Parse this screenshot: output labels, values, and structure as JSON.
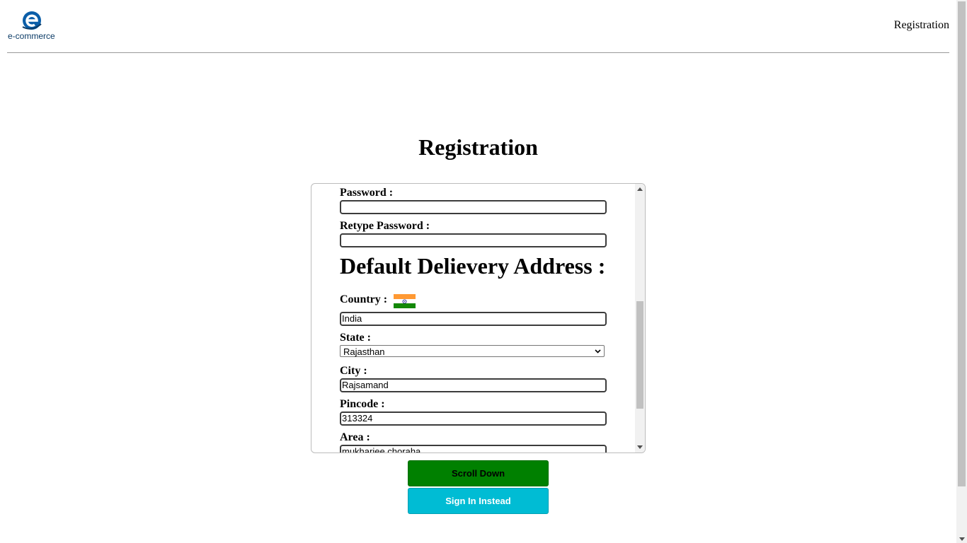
{
  "header": {
    "brand": "e-commerce",
    "nav_link": "Registration"
  },
  "page_title": "Registration",
  "form": {
    "password_label": "Password :",
    "password_value": "",
    "retype_password_label": "Retype Password :",
    "retype_password_value": "",
    "section_heading": "Default Delievery Address :",
    "country_label": "Country :",
    "country_value": "India",
    "state_label": "State :",
    "state_value": "Rajasthan",
    "city_label": "City :",
    "city_value": "Rajsamand",
    "pincode_label": "Pincode :",
    "pincode_value": "313324",
    "area_label": "Area :",
    "area_value": "mukharjee choraha"
  },
  "buttons": {
    "scroll_down": "Scroll Down",
    "sign_in": "Sign In Instead"
  },
  "colors": {
    "logo_blue": "#0b5ea8",
    "scroll_button": "#008000",
    "signin_button": "#00bcd4",
    "flag_saffron": "#ff9933",
    "flag_green": "#138808",
    "flag_chakra": "#000080"
  },
  "icons": {
    "logo": "e-commerce-logo-icon",
    "flag": "india-flag-icon"
  }
}
